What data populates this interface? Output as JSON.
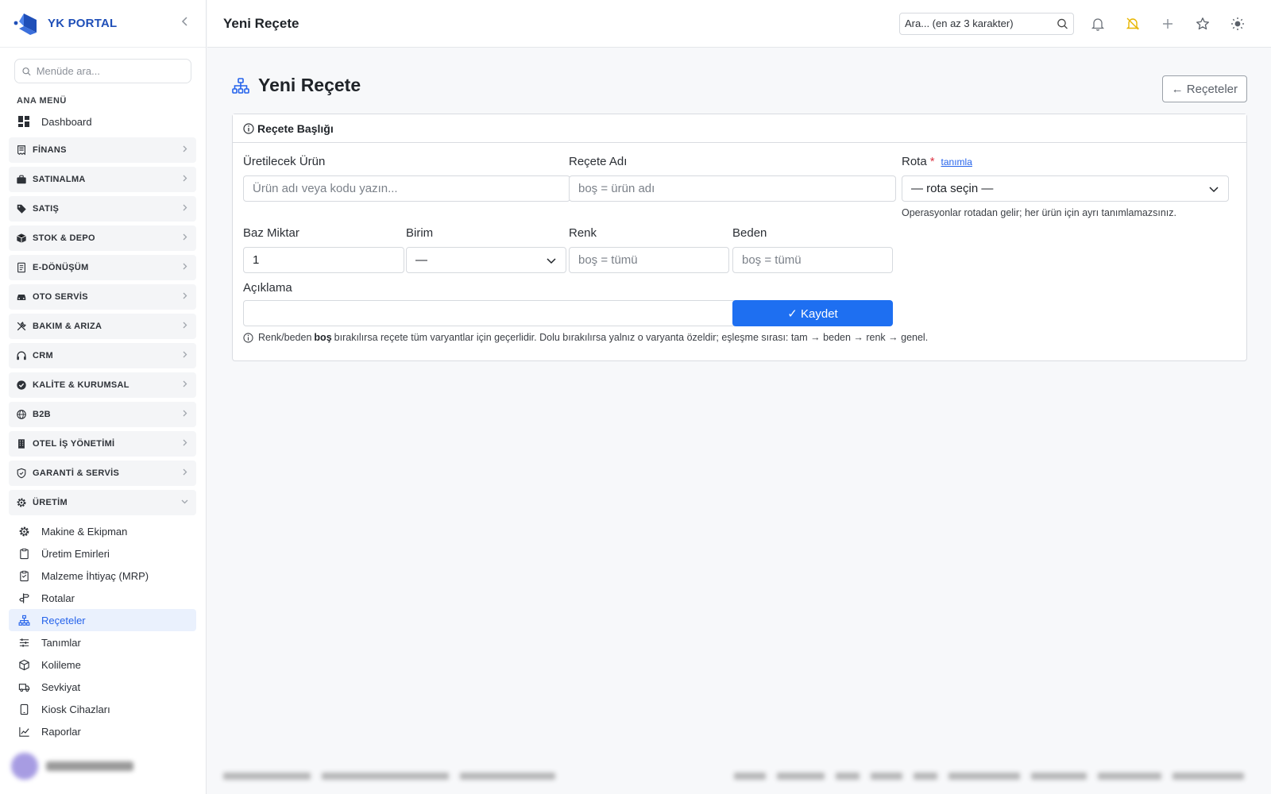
{
  "sidebar": {
    "brand": "YK PORTAL",
    "search_placeholder": "Menüde ara...",
    "section_title": "ANA MENÜ",
    "dashboard": "Dashboard",
    "groups": [
      {
        "label": "FİNANS",
        "icon": "receipt-icon"
      },
      {
        "label": "SATINALMA",
        "icon": "briefcase-icon"
      },
      {
        "label": "SATIŞ",
        "icon": "tag-icon"
      },
      {
        "label": "STOK & DEPO",
        "icon": "box-icon"
      },
      {
        "label": "E-DÖNÜŞÜM",
        "icon": "document-icon"
      },
      {
        "label": "OTO SERVİS",
        "icon": "car-icon"
      },
      {
        "label": "BAKIM & ARIZA",
        "icon": "tools-icon"
      },
      {
        "label": "CRM",
        "icon": "headset-icon"
      },
      {
        "label": "KALİTE & KURUMSAL",
        "icon": "badge-check-icon"
      },
      {
        "label": "B2B",
        "icon": "globe-icon"
      },
      {
        "label": "OTEL İŞ YÖNETİMİ",
        "icon": "building-icon"
      },
      {
        "label": "GARANTİ & SERVİS",
        "icon": "shield-icon"
      },
      {
        "label": "ÜRETİM",
        "icon": "gear-icon"
      }
    ],
    "production_items": [
      {
        "label": "Makine & Ekipman",
        "icon": "gear-icon",
        "active": false
      },
      {
        "label": "Üretim Emirleri",
        "icon": "clipboard-icon",
        "active": false
      },
      {
        "label": "Malzeme İhtiyaç (MRP)",
        "icon": "clipboard-list-icon",
        "active": false
      },
      {
        "label": "Rotalar",
        "icon": "signpost-icon",
        "active": false
      },
      {
        "label": "Reçeteler",
        "icon": "hierarchy-icon",
        "active": true
      },
      {
        "label": "Tanımlar",
        "icon": "sliders-icon",
        "active": false
      },
      {
        "label": "Kolileme",
        "icon": "package-icon",
        "active": false
      },
      {
        "label": "Sevkiyat",
        "icon": "truck-icon",
        "active": false
      },
      {
        "label": "Kiosk Cihazları",
        "icon": "tablet-icon",
        "active": false
      },
      {
        "label": "Raporlar",
        "icon": "chart-line-icon",
        "active": false
      }
    ]
  },
  "topbar": {
    "title": "Yeni Reçete",
    "search_placeholder": "Ara... (en az 3 karakter)"
  },
  "page": {
    "heading": "Yeni Reçete",
    "back_label": "← Reçeteler",
    "card_title": "Reçete Başlığı",
    "fields": {
      "product_label": "Üretilecek Ürün",
      "product_placeholder": "Ürün adı veya kodu yazın...",
      "name_label": "Reçete Adı",
      "name_placeholder": "boş = ürün adı",
      "route_label": "Rota",
      "route_required": "*",
      "route_link": "tanımla",
      "route_value": "— rota seçin —",
      "route_hint": "Operasyonlar rotadan gelir; her ürün için ayrı tanımlamazsınız.",
      "qty_label": "Baz Miktar",
      "qty_value": "1",
      "unit_label": "Birim",
      "unit_value": "—",
      "color_label": "Renk",
      "color_placeholder": "boş = tümü",
      "size_label": "Beden",
      "size_placeholder": "boş = tümü",
      "desc_label": "Açıklama",
      "desc_value": ""
    },
    "save_label": "✓ Kaydet",
    "note_pre": "Renk/beden",
    "note_bold": "boş",
    "note_post": "bırakılırsa reçete tüm varyantlar için geçerlidir. Dolu bırakılırsa yalnız o varyanta özeldir; eşleşme sırası: tam → beden → renk → genel."
  },
  "colors": {
    "accent": "#2563eb",
    "save_button": "#1e6ff1",
    "active_bg": "#eaf1fd",
    "required": "#dc3545",
    "bell_alert": "#e8b600"
  }
}
